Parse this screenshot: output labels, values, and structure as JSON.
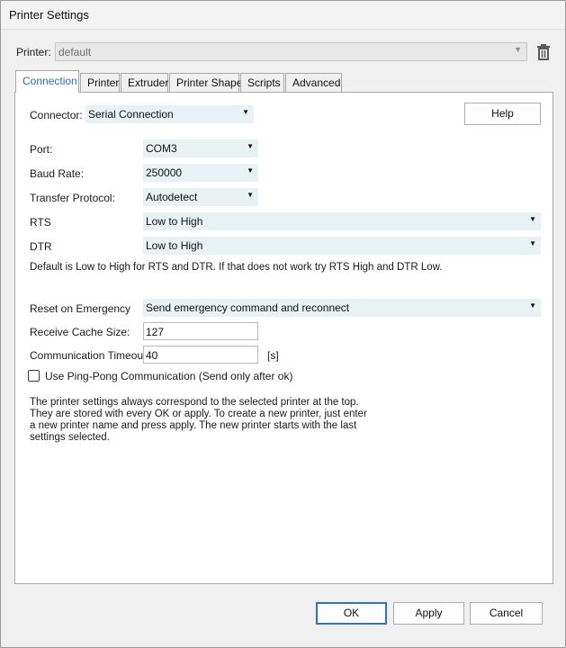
{
  "window": {
    "title": "Printer Settings"
  },
  "printer": {
    "label": "Printer:",
    "value": "default"
  },
  "tabs": [
    {
      "label": "Connection"
    },
    {
      "label": "Printer"
    },
    {
      "label": "Extruder"
    },
    {
      "label": "Printer Shape"
    },
    {
      "label": "Scripts"
    },
    {
      "label": "Advanced"
    }
  ],
  "connection": {
    "connector_label": "Connector:",
    "connector_value": "Serial Connection",
    "help_label": "Help",
    "port_label": "Port:",
    "port_value": "COM3",
    "baud_label": "Baud Rate:",
    "baud_value": "250000",
    "protocol_label": "Transfer Protocol:",
    "protocol_value": "Autodetect",
    "rts_label": "RTS",
    "rts_value": "Low to High",
    "dtr_label": "DTR",
    "dtr_value": "Low to High",
    "rts_dtr_hint": "Default is Low to High for RTS and DTR. If that does not work try RTS High and DTR Low.",
    "reset_label": "Reset on Emergency",
    "reset_value": "Send emergency command and reconnect",
    "cache_label": "Receive Cache Size:",
    "cache_value": "127",
    "timeout_label": "Communication Timeout:",
    "timeout_value": "40",
    "timeout_unit": "[s]",
    "pingpong_label": "Use Ping-Pong Communication (Send only after ok)",
    "pingpong_checked": false,
    "info_text": "The printer settings always correspond to the selected printer at the top. They are stored with every OK or apply. To create a new printer, just enter a new printer name and press apply. The new printer starts with the last settings selected."
  },
  "footer": {
    "ok_label": "OK",
    "apply_label": "Apply",
    "cancel_label": "Cancel"
  }
}
